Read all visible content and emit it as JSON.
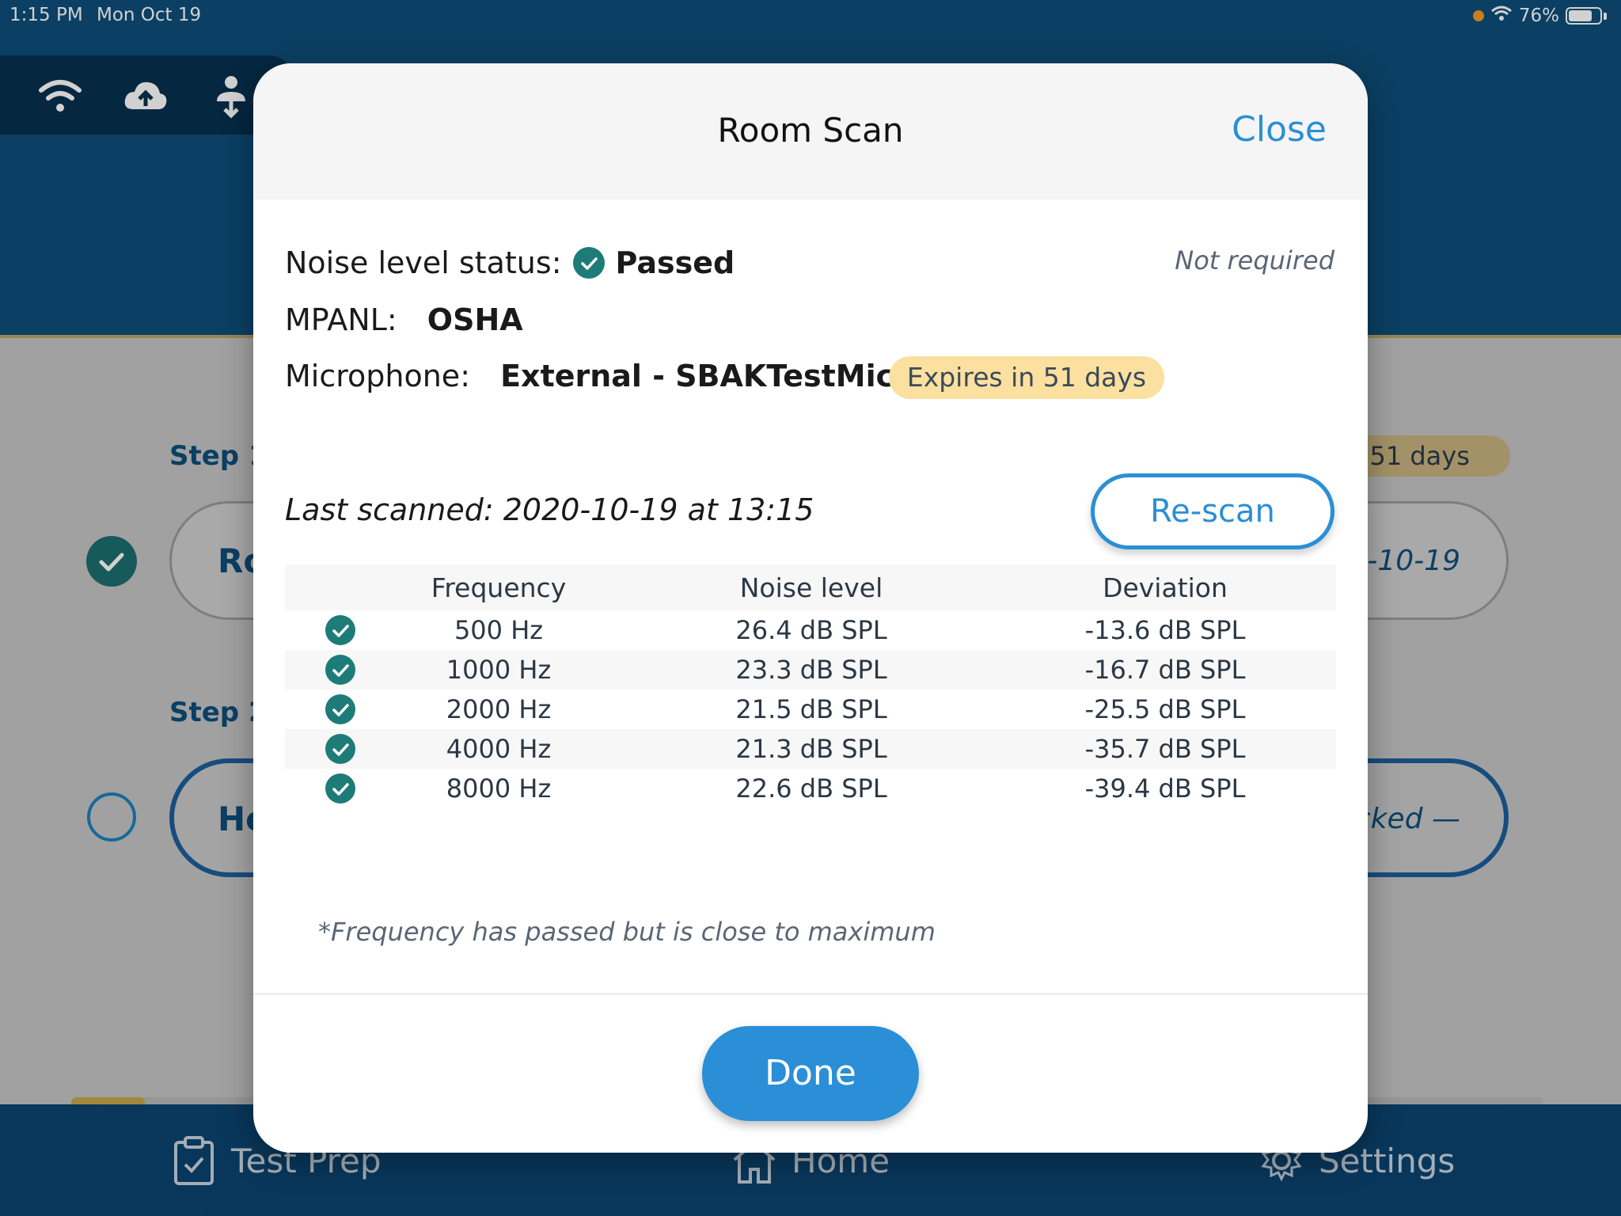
{
  "status_bar": {
    "time": "1:15 PM",
    "date": "Mon Oct 19",
    "battery": "76%",
    "battery_level": 0.76
  },
  "background": {
    "step1_label": "Step 1",
    "step1_text": "Ro",
    "step1_date": "0-10-19",
    "step1_badge": "n 51 days",
    "step2_label": "Step 2",
    "step2_text": "He",
    "step2_status": "cked —",
    "progress": 0.05
  },
  "bottom_nav": {
    "test_prep": "Test Prep",
    "home": "Home",
    "settings": "Settings"
  },
  "modal": {
    "title": "Room Scan",
    "close": "Close",
    "noise_label": "Noise level status:",
    "noise_value": "Passed",
    "not_required": "Not required",
    "mpanl_label": "MPANL:",
    "mpanl_value": "OSHA",
    "mic_label": "Microphone:",
    "mic_value": "External - SBAKTestMic1",
    "expires": "Expires in 51 days",
    "last_scanned": "Last scanned: 2020-10-19 at 13:15",
    "rescan": "Re-scan",
    "table": {
      "headers": {
        "frequency": "Frequency",
        "noise": "Noise level",
        "deviation": "Deviation"
      },
      "rows": [
        {
          "frequency": "500 Hz",
          "noise": "26.4 dB SPL",
          "deviation": "-13.6 dB SPL"
        },
        {
          "frequency": "1000 Hz",
          "noise": "23.3 dB SPL",
          "deviation": "-16.7 dB SPL"
        },
        {
          "frequency": "2000 Hz",
          "noise": "21.5 dB SPL",
          "deviation": "-25.5 dB SPL"
        },
        {
          "frequency": "4000 Hz",
          "noise": "21.3 dB SPL",
          "deviation": "-35.7 dB SPL"
        },
        {
          "frequency": "8000 Hz",
          "noise": "22.6 dB SPL",
          "deviation": "-39.4 dB SPL"
        }
      ]
    },
    "footnote": "*Frequency has passed but is close to maximum",
    "done": "Done"
  },
  "colors": {
    "accent": "#2a8fd6",
    "header": "#0e4d79",
    "check": "#1e7c78",
    "badge": "#fbe0a0"
  }
}
